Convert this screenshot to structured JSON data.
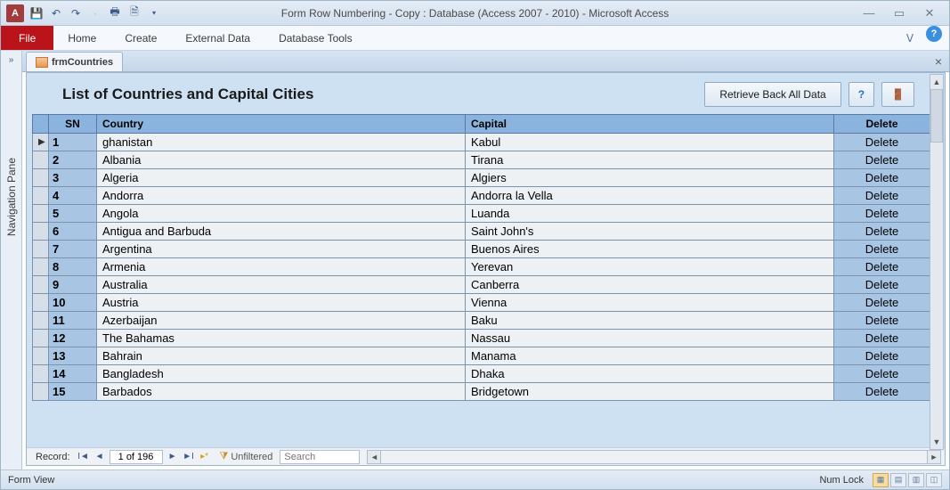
{
  "app_icon_letter": "A",
  "window_title": "Form Row Numbering - Copy : Database (Access 2007 - 2010)  -  Microsoft Access",
  "qat": {
    "undo_glyph": "↶",
    "redo_glyph": "↷"
  },
  "ribbon": {
    "file": "File",
    "tabs": [
      "Home",
      "Create",
      "External Data",
      "Database Tools"
    ]
  },
  "nav_pane_label": "Navigation Pane",
  "object_tab": "frmCountries",
  "form": {
    "title": "List of Countries and Capital Cities",
    "buttons": {
      "retrieve": "Retrieve Back All Data",
      "help_glyph": "?"
    },
    "columns": {
      "sn": "SN",
      "country": "Country",
      "capital": "Capital",
      "delete": "Delete"
    },
    "delete_label": "Delete",
    "rows": [
      {
        "sn": "1",
        "country": "ghanistan",
        "capital": "Kabul"
      },
      {
        "sn": "2",
        "country": "Albania",
        "capital": "Tirana"
      },
      {
        "sn": "3",
        "country": "Algeria",
        "capital": "Algiers"
      },
      {
        "sn": "4",
        "country": "Andorra",
        "capital": "Andorra la Vella"
      },
      {
        "sn": "5",
        "country": "Angola",
        "capital": "Luanda"
      },
      {
        "sn": "6",
        "country": "Antigua and Barbuda",
        "capital": "Saint John's"
      },
      {
        "sn": "7",
        "country": "Argentina",
        "capital": "Buenos Aires"
      },
      {
        "sn": "8",
        "country": "Armenia",
        "capital": "Yerevan"
      },
      {
        "sn": "9",
        "country": "Australia",
        "capital": "Canberra"
      },
      {
        "sn": "10",
        "country": "Austria",
        "capital": "Vienna"
      },
      {
        "sn": "11",
        "country": "Azerbaijan",
        "capital": "Baku"
      },
      {
        "sn": "12",
        "country": "The Bahamas",
        "capital": "Nassau"
      },
      {
        "sn": "13",
        "country": "Bahrain",
        "capital": "Manama"
      },
      {
        "sn": "14",
        "country": "Bangladesh",
        "capital": "Dhaka"
      },
      {
        "sn": "15",
        "country": "Barbados",
        "capital": "Bridgetown"
      }
    ]
  },
  "recnav": {
    "label": "Record:",
    "position": "1 of 196",
    "filter": "Unfiltered",
    "search_placeholder": "Search"
  },
  "statusbar": {
    "left": "Form View",
    "numlock": "Num Lock"
  }
}
